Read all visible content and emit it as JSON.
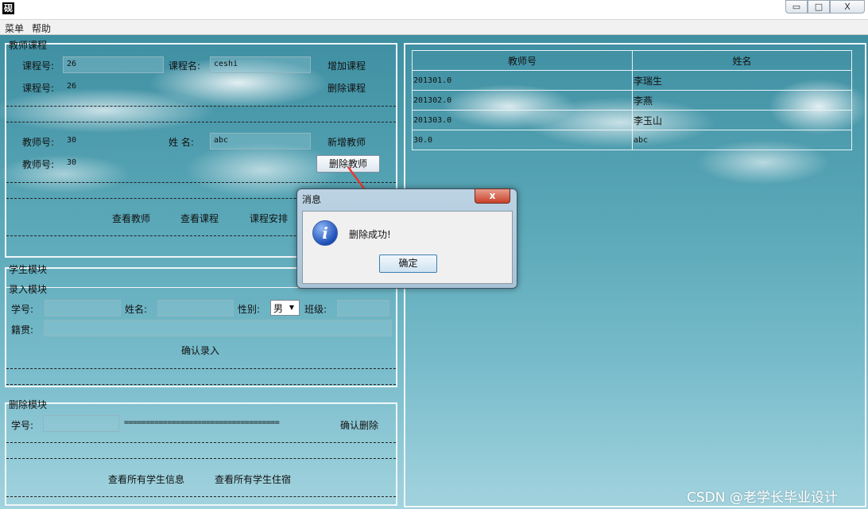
{
  "window": {
    "icon_char": "砚",
    "min": "▭",
    "max": "□",
    "close": "X"
  },
  "menu": {
    "items": [
      "菜单",
      "帮助"
    ]
  },
  "teacher_course": {
    "title": "教师课程",
    "course_no_label": "课程号:",
    "course_no_value": "26",
    "course_name_label": "课程名:",
    "course_name_value": "ceshi",
    "add_course": "增加课程",
    "course_no2_label": "课程号:",
    "course_no2_value": "26",
    "delete_course": "删除课程",
    "teacher_no_label": "教师号:",
    "teacher_no_value": "30",
    "name_label": "姓 名:",
    "name_value": "abc",
    "add_teacher": "新增教师",
    "teacher_no2_label": "教师号:",
    "teacher_no2_value": "30",
    "delete_teacher": "删除教师",
    "view_teachers": "查看教师",
    "view_courses": "查看课程",
    "course_schedule": "课程安排"
  },
  "student": {
    "title": "学生模块",
    "entry_title": "录入模块",
    "student_no_label": "学号:",
    "name_label": "姓名:",
    "gender_label": "性别:",
    "gender_value": "男",
    "class_label": "班级:",
    "native_label": "籍贯:",
    "confirm_entry": "确认录入",
    "delete_title": "删除模块",
    "del_student_no_label": "学号:",
    "separator": "====================================",
    "confirm_delete": "确认删除",
    "view_all_students": "查看所有学生信息",
    "view_all_dorm": "查看所有学生住宿"
  },
  "table": {
    "headers": [
      "教师号",
      "姓名"
    ],
    "rows": [
      [
        "201301.0",
        "李瑞生"
      ],
      [
        "201302.0",
        "李燕"
      ],
      [
        "201303.0",
        "李玉山"
      ],
      [
        "30.0",
        "abc"
      ]
    ]
  },
  "dialog": {
    "title": "消息",
    "close": "x",
    "message": "删除成功!",
    "ok": "确定",
    "icon": "i"
  },
  "watermark": "CSDN @老学长毕业设计"
}
